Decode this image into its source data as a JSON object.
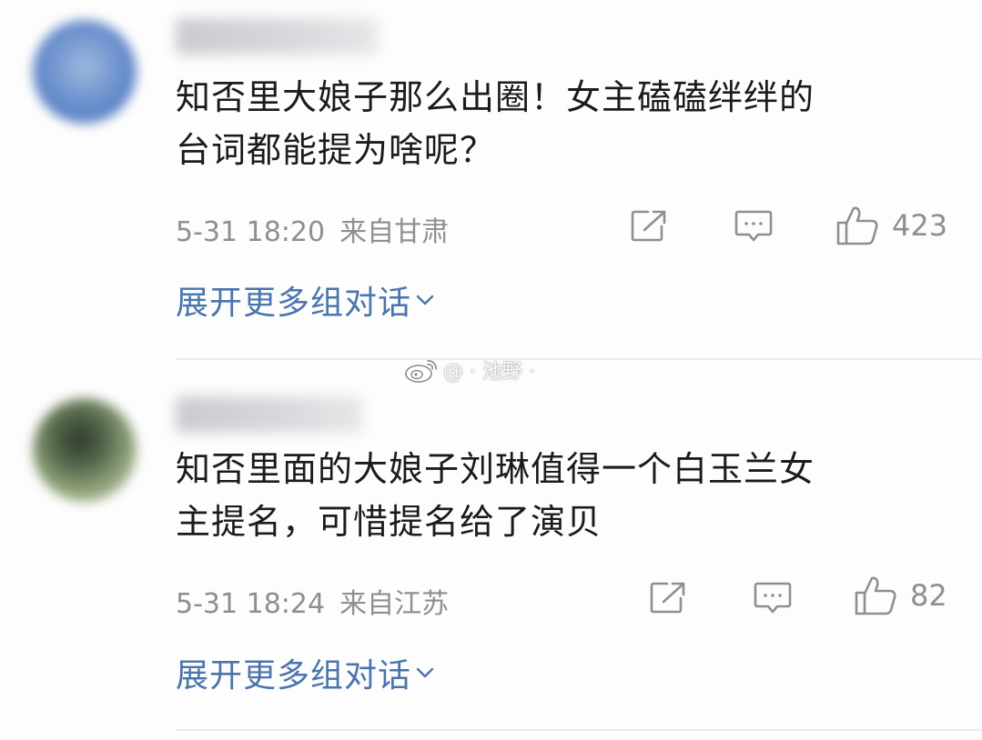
{
  "comments": [
    {
      "content_line1": "知否里大娘子那么出圈！女主磕磕绊绊的",
      "content_line2": "台词都能提为啥呢？",
      "timestamp": "5-31 18:20",
      "location": "来自甘肃",
      "likes": "423",
      "expand_label": "展开更多组对话"
    },
    {
      "content_line1": "知否里面的大娘子刘琳值得一个白玉兰女",
      "content_line2": "主提名，可惜提名给了演贝",
      "timestamp": "5-31 18:24",
      "location": "来自江苏",
      "likes": "82",
      "expand_label": "展开更多组对话"
    }
  ],
  "watermark": {
    "text": "@ · 池野 ·"
  },
  "icons": {
    "share": "share-icon",
    "reply": "comment-icon",
    "like": "thumbs-up-icon",
    "expand": "chevron-down-icon",
    "weibo": "weibo-logo-icon"
  },
  "colors": {
    "link": "#4a74ad",
    "meta": "#8f8f8f",
    "text": "#1b1b1b"
  }
}
